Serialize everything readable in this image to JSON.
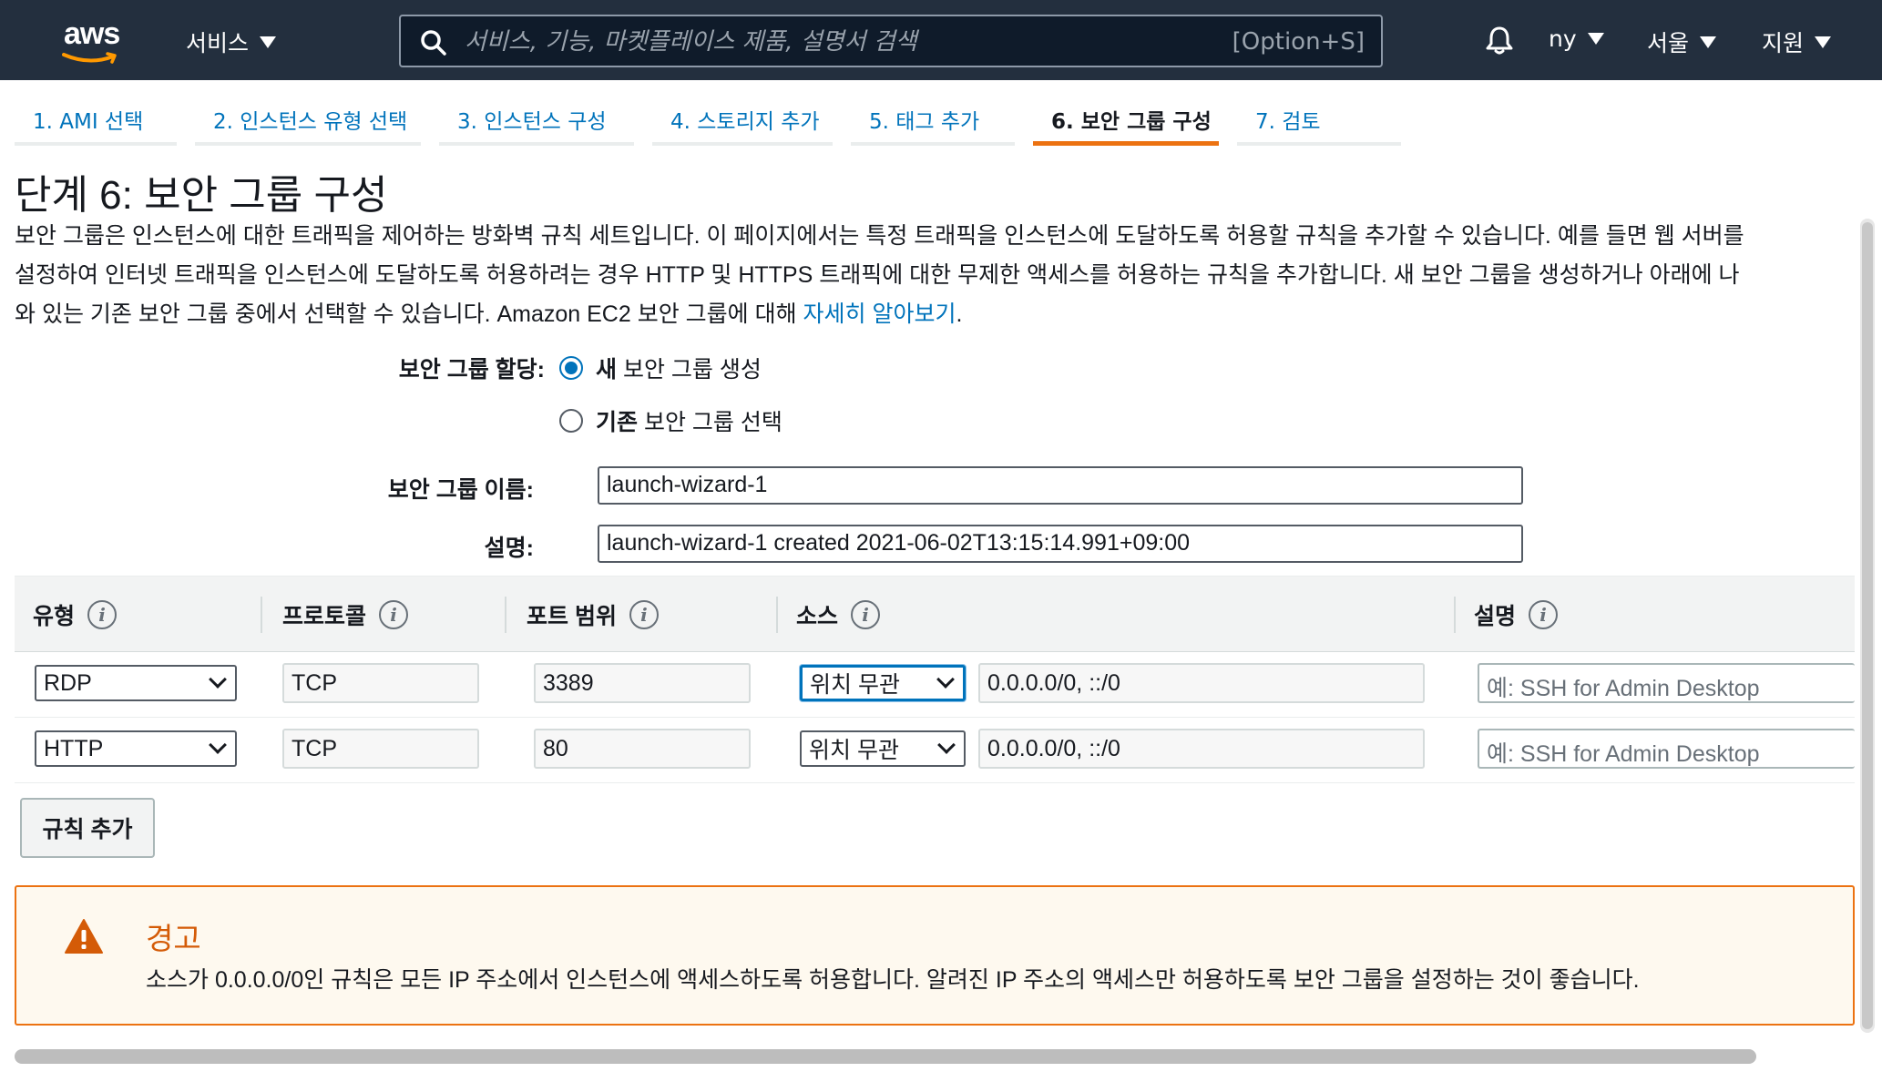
{
  "topnav": {
    "logo_text": "aws",
    "services_label": "서비스",
    "search_placeholder": "서비스, 기능, 마켓플레이스 제품, 설명서 검색",
    "search_shortcut": "[Option+S]",
    "account_label": "ny",
    "region_label": "서울",
    "support_label": "지원"
  },
  "tabs": [
    {
      "label": "1. AMI 선택",
      "active": false
    },
    {
      "label": "2. 인스턴스 유형 선택",
      "active": false
    },
    {
      "label": "3. 인스턴스 구성",
      "active": false
    },
    {
      "label": "4. 스토리지 추가",
      "active": false
    },
    {
      "label": "5. 태그 추가",
      "active": false
    },
    {
      "label": "6. 보안 그룹 구성",
      "active": true
    },
    {
      "label": "7. 검토",
      "active": false
    }
  ],
  "page": {
    "title": "단계 6: 보안 그룹 구성",
    "intro_line1": "보안 그룹은 인스턴스에 대한 트래픽을 제어하는 방화벽 규칙 세트입니다. 이 페이지에서는 특정 트래픽을 인스턴스에 도달하도록 허용할 규칙을 추가할 수 있습니다. 예를 들면 웹 서버를",
    "intro_line2": "설정하여 인터넷 트래픽을 인스턴스에 도달하도록 허용하려는 경우 HTTP 및 HTTPS 트래픽에 대한 무제한 액세스를 허용하는 규칙을 추가합니다. 새 보안 그룹을 생성하거나 아래에 나",
    "intro_line3": "와 있는 기존 보안 그룹 중에서 선택할 수 있습니다. Amazon EC2 보안 그룹에 대해 ",
    "learn_more": "자세히 알아보기",
    "intro_end": "."
  },
  "form": {
    "assign_label": "보안 그룹 할당:",
    "option_new_bold": "새",
    "option_new_rest": "보안 그룹 생성",
    "option_new_checked": true,
    "option_existing_bold": "기존",
    "option_existing_rest": "보안 그룹 선택",
    "option_existing_checked": false,
    "name_label": "보안 그룹 이름:",
    "name_value": "launch-wizard-1",
    "desc_label": "설명:",
    "desc_value": "launch-wizard-1 created 2021-06-02T13:15:14.991+09:00"
  },
  "rules_table": {
    "headers": {
      "type": "유형",
      "protocol": "프로토콜",
      "port": "포트 범위",
      "source": "소스",
      "description": "설명"
    },
    "rows": [
      {
        "type": "RDP",
        "protocol": "TCP",
        "port": "3389",
        "source_mode": "위치 무관",
        "source_cidr": "0.0.0.0/0, ::/0",
        "desc_placeholder": "예: SSH for Admin Desktop"
      },
      {
        "type": "HTTP",
        "protocol": "TCP",
        "port": "80",
        "source_mode": "위치 무관",
        "source_cidr": "0.0.0.0/0, ::/0",
        "desc_placeholder": "예: SSH for Admin Desktop"
      }
    ],
    "add_rule_label": "규칙 추가"
  },
  "warning": {
    "title": "경고",
    "body": "소스가 0.0.0.0/0인 규칙은 모든 IP 주소에서 인스턴스에 액세스하도록 허용합니다. 알려진 IP 주소의 액세스만 허용하도록 보안 그룹을 설정하는 것이 좋습니다."
  },
  "colors": {
    "nav_bg": "#232f3e",
    "link": "#0073bb",
    "accent": "#ec7211",
    "warning_bg": "#fef9ef",
    "warning_title": "#d45b07"
  },
  "icons": [
    "search-icon",
    "bell-icon",
    "info-icon",
    "warning-icon",
    "caret-down-icon",
    "chevron-down-icon"
  ]
}
